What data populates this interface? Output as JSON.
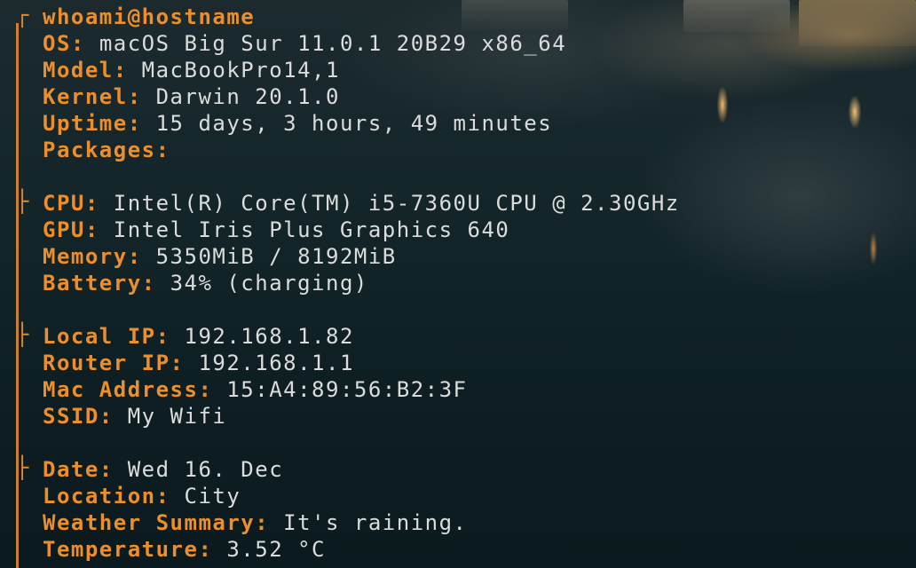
{
  "terminal": {
    "title": "whoami@hostname",
    "sections": [
      {
        "fields": [
          {
            "key": "OS",
            "value": "macOS Big Sur 11.0.1 20B29 x86_64"
          },
          {
            "key": "Model",
            "value": "MacBookPro14,1"
          },
          {
            "key": "Kernel",
            "value": "Darwin 20.1.0"
          },
          {
            "key": "Uptime",
            "value": "15 days, 3 hours, 49 minutes"
          },
          {
            "key": "Packages",
            "value": ""
          }
        ]
      },
      {
        "fields": [
          {
            "key": "CPU",
            "value": "Intel(R) Core(TM) i5-7360U CPU @ 2.30GHz"
          },
          {
            "key": "GPU",
            "value": "Intel Iris Plus Graphics 640"
          },
          {
            "key": "Memory",
            "value": "5350MiB / 8192MiB"
          },
          {
            "key": "Battery",
            "value": "34% (charging)"
          }
        ]
      },
      {
        "fields": [
          {
            "key": "Local IP",
            "value": "192.168.1.82"
          },
          {
            "key": "Router IP",
            "value": "192.168.1.1"
          },
          {
            "key": "Mac Address",
            "value": "15:A4:89:56:B2:3F"
          },
          {
            "key": "SSID",
            "value": "My Wifi"
          }
        ]
      },
      {
        "fields": [
          {
            "key": "Date",
            "value": "Wed 16. Dec"
          },
          {
            "key": "Location",
            "value": "City"
          },
          {
            "key": "Weather Summary",
            "value": "It's raining."
          },
          {
            "key": "Temperature",
            "value": "3.52 °C"
          }
        ]
      }
    ]
  },
  "colors": {
    "accent": "#eb8f2e",
    "text": "#dcdcdc",
    "background": "#0f1e22"
  }
}
